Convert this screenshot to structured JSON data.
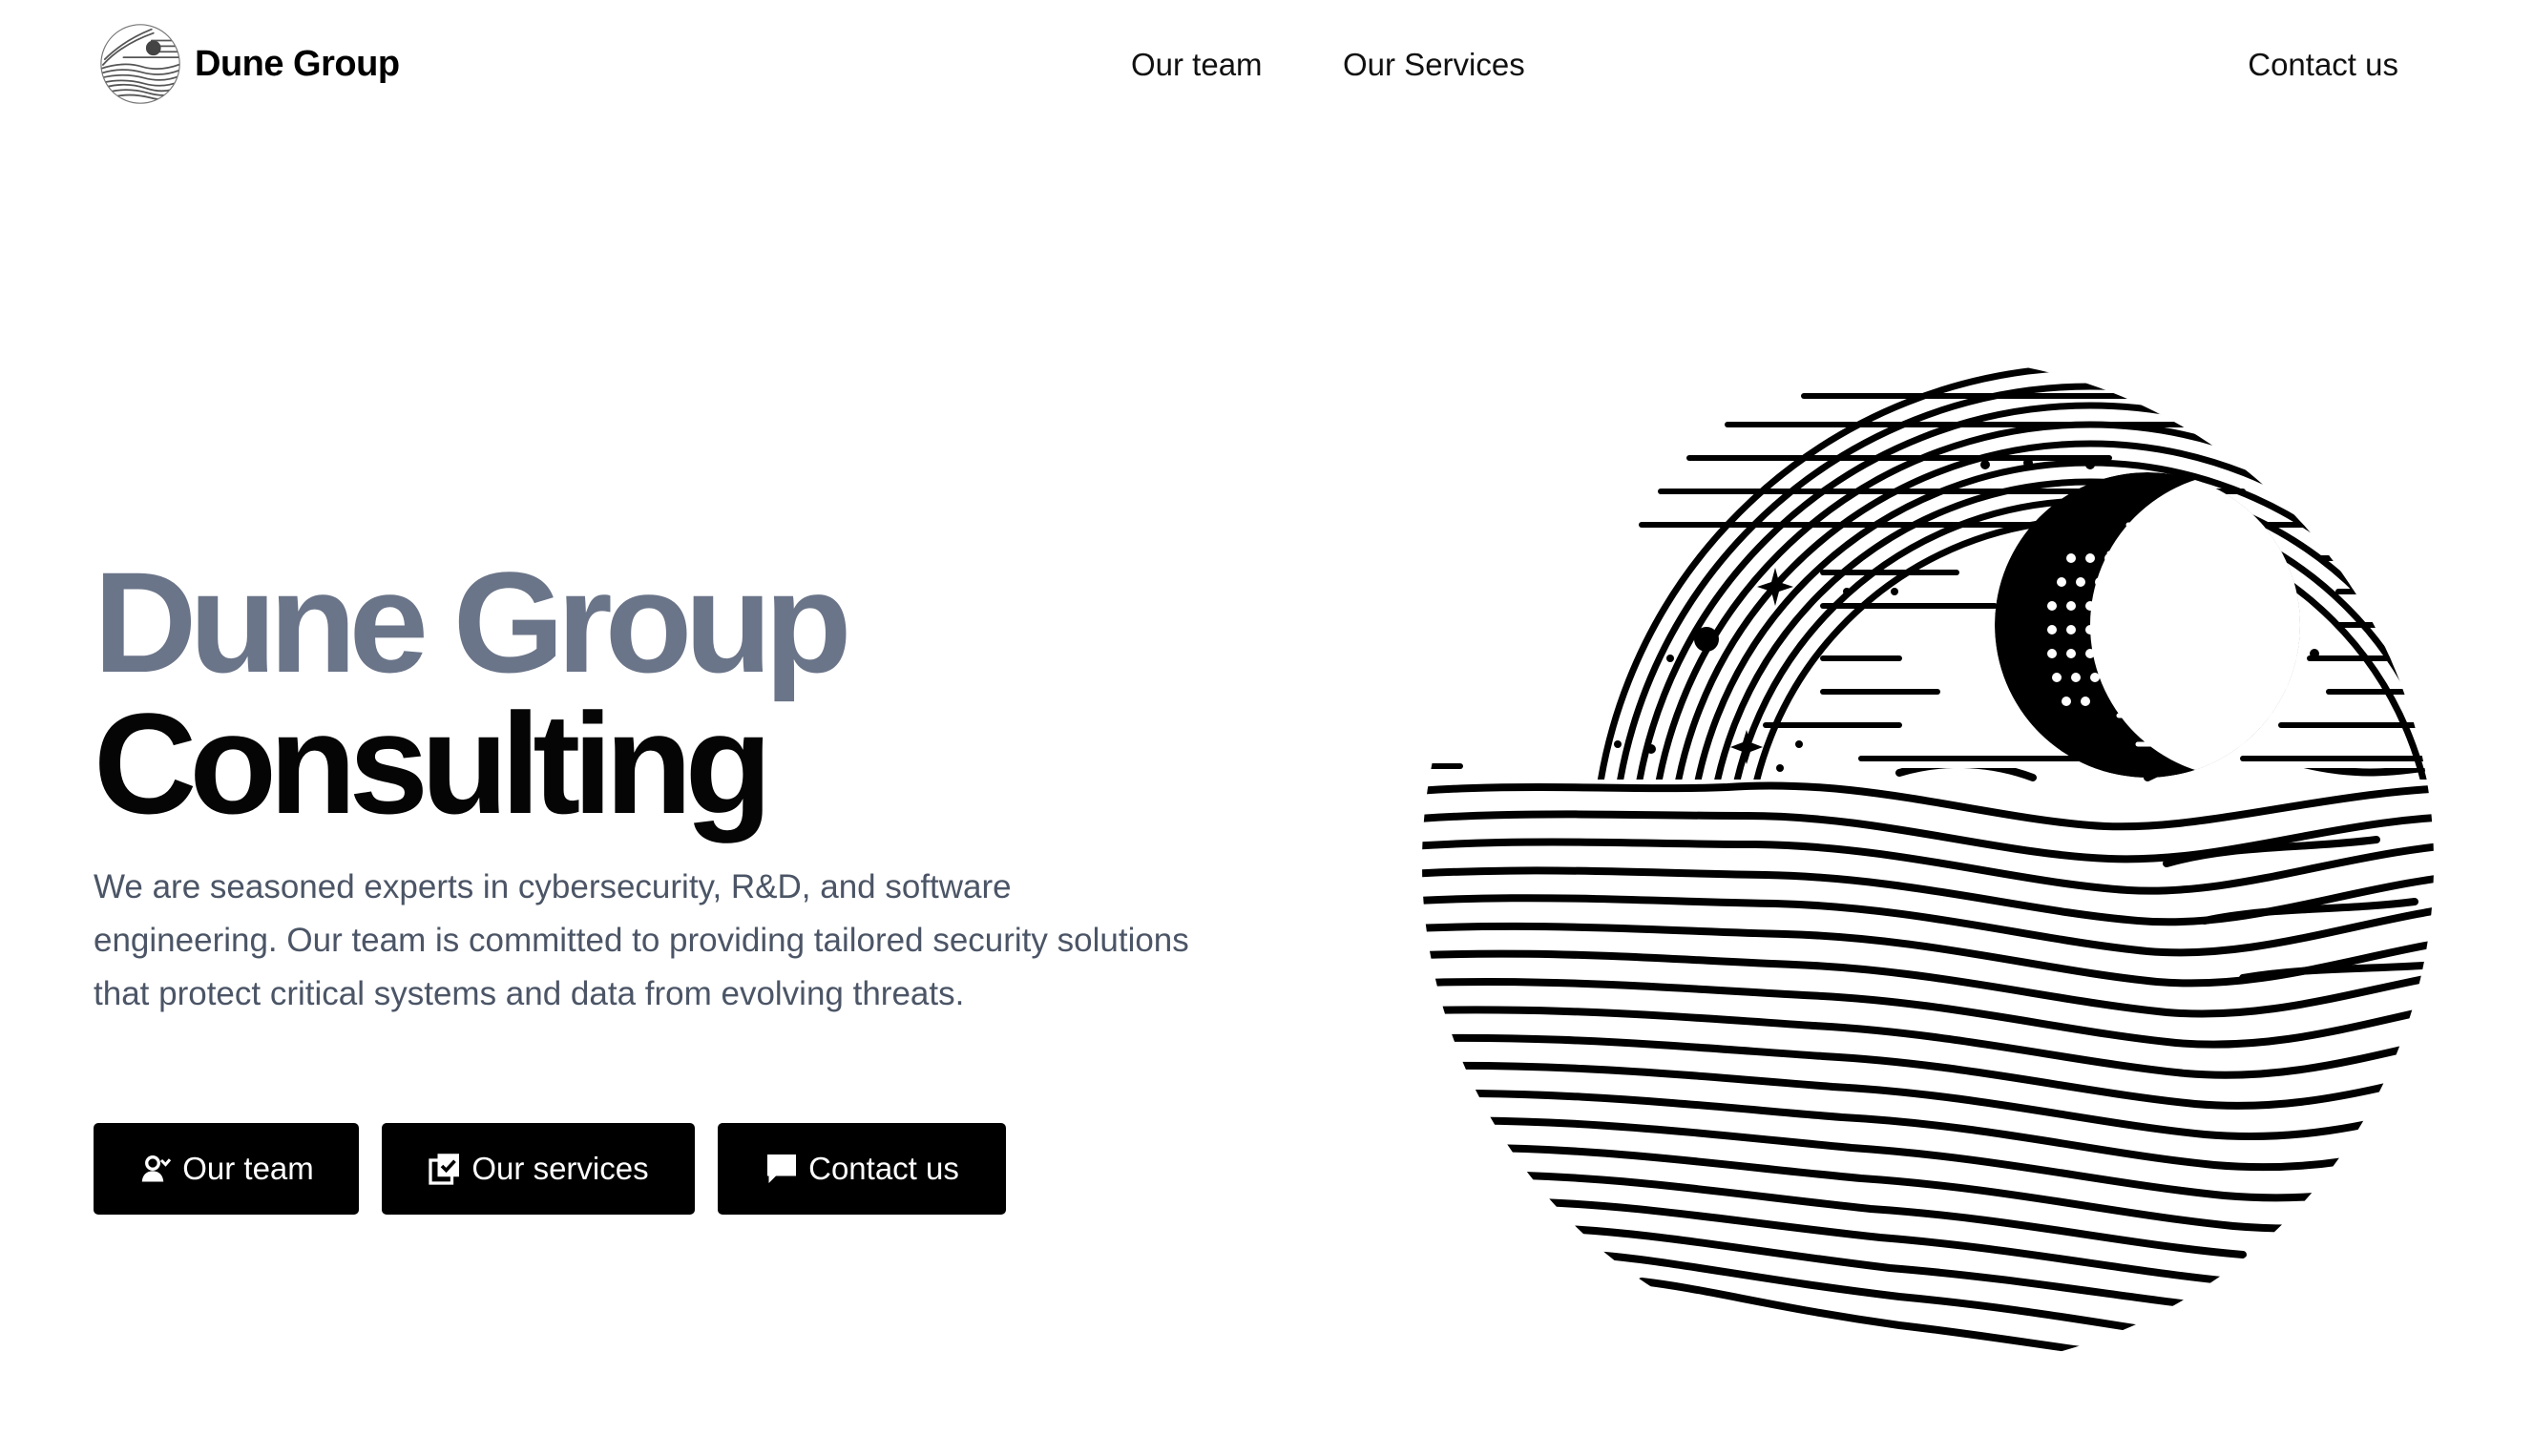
{
  "brand": {
    "name": "Dune Group",
    "logo_icon": "dune-wave-logo-icon"
  },
  "nav": {
    "links": [
      "Our team",
      "Our Services"
    ],
    "contact": "Contact us"
  },
  "hero": {
    "title_line1": "Dune Group",
    "title_line2": "Consulting",
    "description": "We are seasoned experts in cybersecurity, R&D, and software engineering. Our team is committed to providing tailored security solutions that protect critical systems and data from evolving threats."
  },
  "buttons": [
    {
      "label": "Our team",
      "icon": "user-icon"
    },
    {
      "label": "Our services",
      "icon": "checklist-icon"
    },
    {
      "label": "Contact us",
      "icon": "chat-bubble-icon"
    }
  ],
  "illustration": {
    "icon": "dune-moon-waves-illustration"
  },
  "colors": {
    "accent_title": "#6b7589",
    "body_text": "#4b5566",
    "button_bg": "#000000",
    "button_text": "#ffffff",
    "background": "#ffffff"
  }
}
